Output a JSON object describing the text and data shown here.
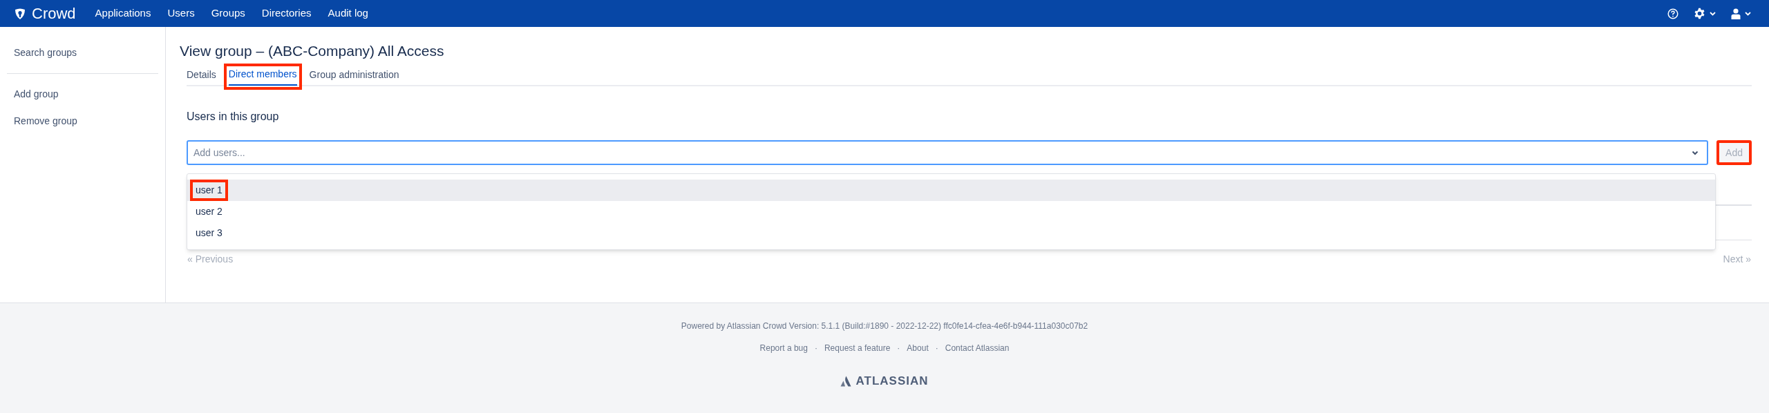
{
  "nav": {
    "product": "Crowd",
    "items": [
      "Applications",
      "Users",
      "Groups",
      "Directories",
      "Audit log"
    ]
  },
  "sidebar": {
    "groups": [
      [
        "Search groups"
      ],
      [
        "Add group",
        "Remove group"
      ]
    ]
  },
  "page": {
    "title": "View group – (ABC-Company) All Access"
  },
  "tabs": [
    {
      "label": "Details",
      "selected": false,
      "highlighted": false
    },
    {
      "label": "Direct members",
      "selected": true,
      "highlighted": true
    },
    {
      "label": "Group administration",
      "selected": false,
      "highlighted": false
    }
  ],
  "section": {
    "heading": "Users in this group"
  },
  "user_picker": {
    "placeholder": "Add users...",
    "expanded": true,
    "options": [
      {
        "label": "user 1",
        "selected": true,
        "highlighted": true
      },
      {
        "label": "user 2",
        "selected": false,
        "highlighted": false
      },
      {
        "label": "user 3",
        "selected": false,
        "highlighted": false
      }
    ]
  },
  "add_button": {
    "label": "Add",
    "disabled": true,
    "highlighted": true
  },
  "pagination": {
    "previous": "« Previous",
    "next": "Next »"
  },
  "footer": {
    "powered_by": "Powered by Atlassian Crowd Version: 5.1.1 (Build:#1890 - 2022-12-22) ffc0fe14-cfea-4e6f-b944-111a030c07b2",
    "separator": "·",
    "links": [
      "Report a bug",
      "Request a feature",
      "About",
      "Contact Atlassian"
    ],
    "brand": "ATLASSIAN"
  }
}
